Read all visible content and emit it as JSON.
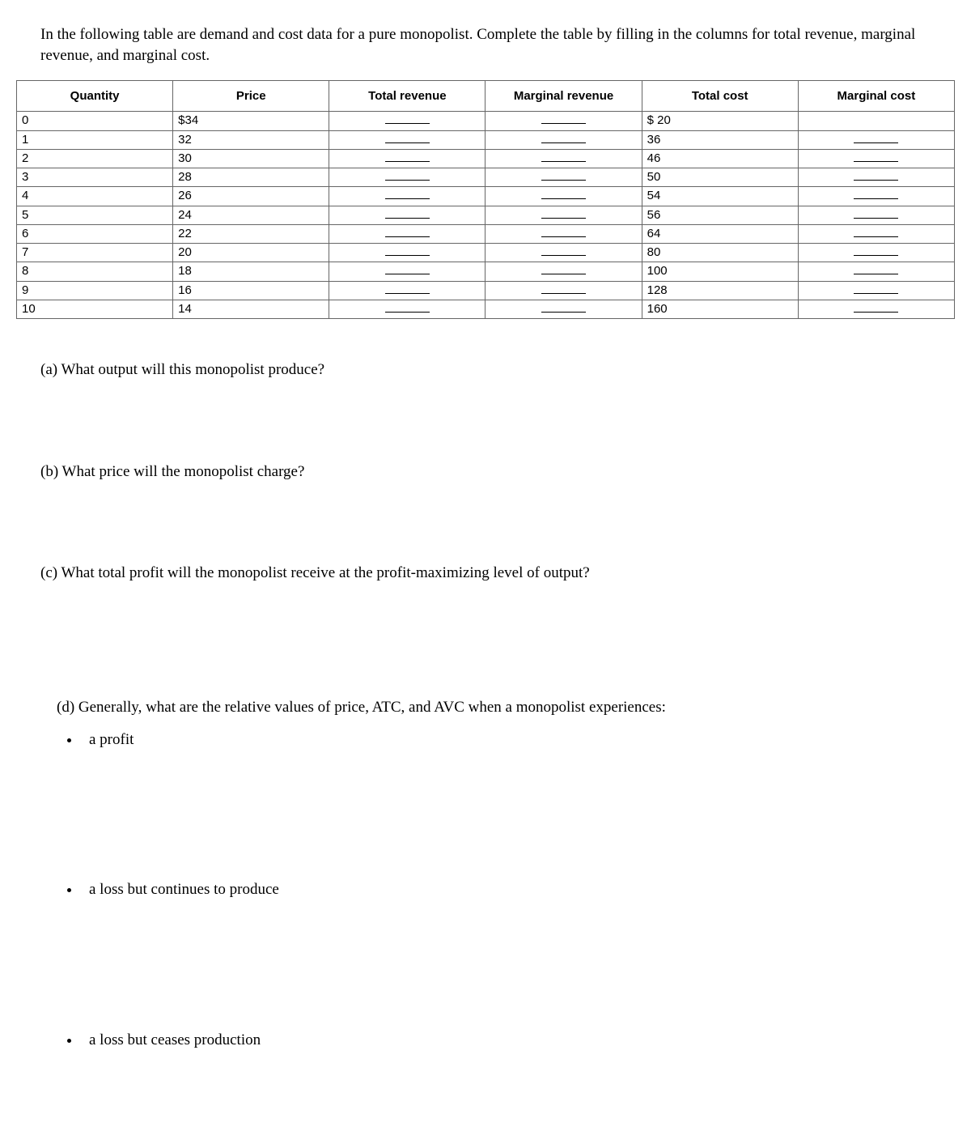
{
  "intro": "In the following table are demand and cost data for a pure monopolist.  Complete the table by filling in the columns for total revenue, marginal revenue, and marginal cost.",
  "table": {
    "headers": {
      "quantity": "Quantity",
      "price": "Price",
      "total_revenue": "Total revenue",
      "marginal_revenue": "Marginal revenue",
      "total_cost": "Total cost",
      "marginal_cost": "Marginal cost"
    },
    "rows": [
      {
        "quantity": "0",
        "price": "$34",
        "total_cost": "$ 20",
        "mc_blank": false
      },
      {
        "quantity": "1",
        "price": "32",
        "total_cost": "36",
        "mc_blank": true
      },
      {
        "quantity": "2",
        "price": "30",
        "total_cost": "46",
        "mc_blank": true
      },
      {
        "quantity": "3",
        "price": "28",
        "total_cost": "50",
        "mc_blank": true
      },
      {
        "quantity": "4",
        "price": "26",
        "total_cost": "54",
        "mc_blank": true
      },
      {
        "quantity": "5",
        "price": "24",
        "total_cost": "56",
        "mc_blank": true
      },
      {
        "quantity": "6",
        "price": "22",
        "total_cost": "64",
        "mc_blank": true
      },
      {
        "quantity": "7",
        "price": "20",
        "total_cost": "80",
        "mc_blank": true
      },
      {
        "quantity": "8",
        "price": "18",
        "total_cost": "100",
        "mc_blank": true
      },
      {
        "quantity": "9",
        "price": "16",
        "total_cost": "128",
        "mc_blank": true
      },
      {
        "quantity": "10",
        "price": "14",
        "total_cost": "160",
        "mc_blank": true
      }
    ]
  },
  "questions": {
    "a": "(a) What output will this monopolist produce?",
    "b": "(b) What price will the monopolist charge?",
    "c": "(c) What total profit will the monopolist receive at the profit-maximizing level of output?",
    "d_intro": "(d) Generally, what are the relative values of price, ATC, and AVC when a monopolist experiences:",
    "d_items": {
      "profit": "a profit",
      "loss_continue": "a loss but continues to produce",
      "loss_cease": "a loss but ceases production"
    }
  }
}
